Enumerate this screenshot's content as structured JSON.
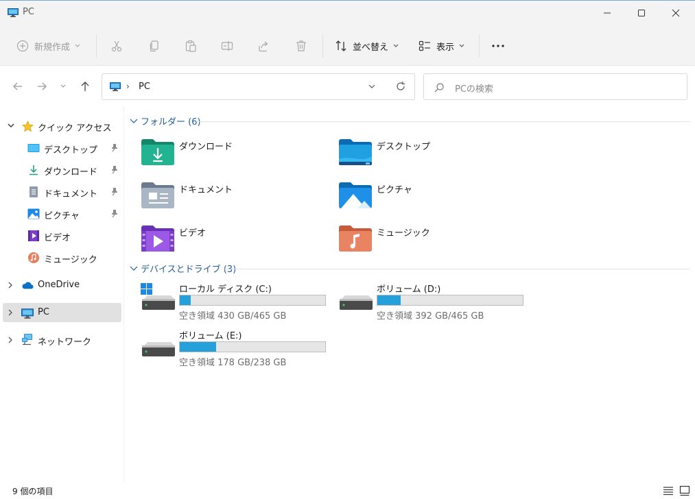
{
  "window": {
    "title": "PC"
  },
  "toolbar": {
    "new_label": "新規作成",
    "sort_label": "並べ替え",
    "view_label": "表示",
    "more_label": "···"
  },
  "address": {
    "crumb": "PC"
  },
  "search": {
    "placeholder": "PCの検索"
  },
  "sidebar": {
    "quick_access": "クイック アクセス",
    "quick_items": [
      {
        "label": "デスクトップ",
        "icon": "desktop-icon"
      },
      {
        "label": "ダウンロード",
        "icon": "download-icon"
      },
      {
        "label": "ドキュメント",
        "icon": "document-icon"
      },
      {
        "label": "ピクチャ",
        "icon": "picture-icon"
      },
      {
        "label": "ビデオ",
        "icon": "video-icon"
      },
      {
        "label": "ミュージック",
        "icon": "music-icon"
      }
    ],
    "onedrive": "OneDrive",
    "pc": "PC",
    "network": "ネットワーク"
  },
  "main": {
    "folders_header": "フォルダー (6)",
    "folders": [
      {
        "label": "ダウンロード",
        "icon": "downloads-folder-icon"
      },
      {
        "label": "デスクトップ",
        "icon": "desktop-folder-icon"
      },
      {
        "label": "ドキュメント",
        "icon": "documents-folder-icon"
      },
      {
        "label": "ピクチャ",
        "icon": "pictures-folder-icon"
      },
      {
        "label": "ビデオ",
        "icon": "videos-folder-icon"
      },
      {
        "label": "ミュージック",
        "icon": "music-folder-icon"
      }
    ],
    "drives_header": "デバイスとドライブ (3)",
    "drives": [
      {
        "label": "ローカル ディスク (C:)",
        "free": "空き領域 430 GB/465 GB",
        "used_fraction": 0.075
      },
      {
        "label": "ボリューム (D:)",
        "free": "空き領域 392 GB/465 GB",
        "used_fraction": 0.16
      },
      {
        "label": "ボリューム (E:)",
        "free": "空き領域 178 GB/238 GB",
        "used_fraction": 0.25
      }
    ]
  },
  "status": {
    "item_count": "9 個の項目"
  },
  "colors": {
    "accent": "#26a0da",
    "group_header": "#1f5c99",
    "selected_bg": "#e1e1e1"
  }
}
